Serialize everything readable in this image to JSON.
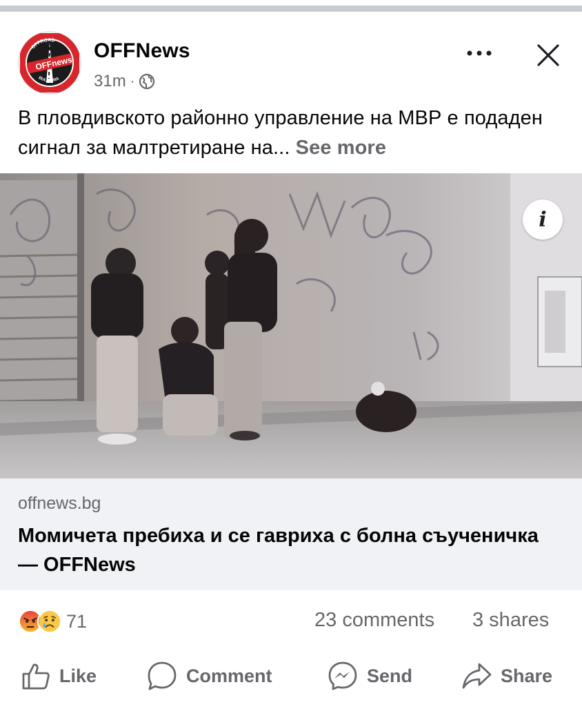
{
  "post": {
    "page_name": "OFFNews",
    "time": "31m",
    "separator": "·",
    "privacy_icon": "globe-icon",
    "text": "В пловдивското районно управление на МВР е подаден сигнал за малтретиране на...",
    "see_more": "See more",
    "avatar_logo_text": [
      "OFFROAD",
      "OFF",
      "news",
      "BULGARIA"
    ]
  },
  "header_controls": {
    "more_icon": "more-dots-icon",
    "close_icon": "close-icon"
  },
  "media": {
    "info_label": "i",
    "info_icon": "info-icon"
  },
  "link_preview": {
    "domain": "offnews.bg",
    "title": "Момичета пребиха и се гавриха с болна съученичка — OFFNews"
  },
  "stats": {
    "reaction_icons": [
      "angry-reaction-icon",
      "sad-reaction-icon"
    ],
    "reaction_count": "71",
    "comments": "23 comments",
    "shares": "3 shares"
  },
  "actions": [
    {
      "label": "Like",
      "icon": "like-icon"
    },
    {
      "label": "Comment",
      "icon": "comment-icon"
    },
    {
      "label": "Send",
      "icon": "messenger-icon"
    },
    {
      "label": "Share",
      "icon": "share-icon"
    }
  ],
  "colors": {
    "divider": "#c9ccd1",
    "secondary_text": "#65676b",
    "link_background": "#f0f2f5",
    "brand_red": "#d7262c"
  }
}
